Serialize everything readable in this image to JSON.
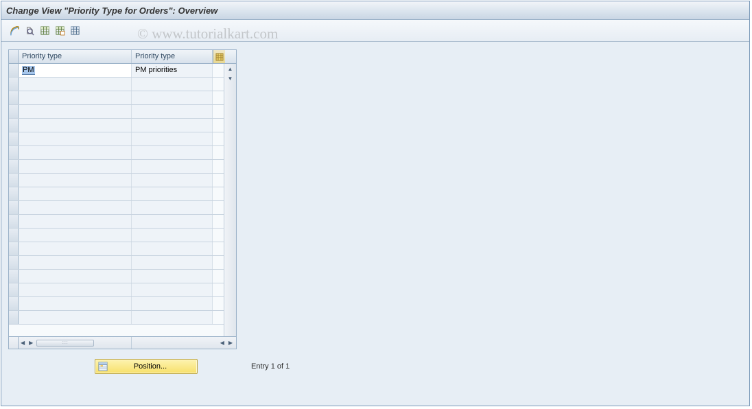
{
  "title": "Change View \"Priority Type for Orders\": Overview",
  "watermark": "© www.tutorialkart.com",
  "toolbar": {
    "icons": [
      "other-view-icon",
      "change-icon",
      "new-entries-icon",
      "copy-icon",
      "delete-icon"
    ]
  },
  "table": {
    "col1_header": "Priority type",
    "col2_header": "Priority type",
    "rows": [
      {
        "code": "PM",
        "desc": "PM priorities"
      }
    ],
    "empty_row_count": 18
  },
  "position_button": {
    "label": "Position..."
  },
  "status_text": "Entry 1 of 1"
}
